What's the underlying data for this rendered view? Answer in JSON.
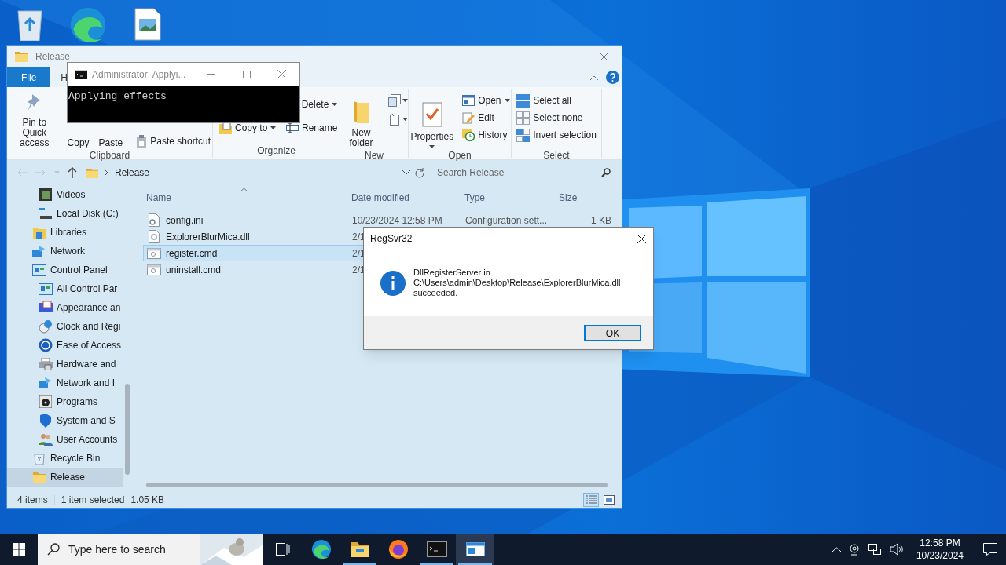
{
  "explorer": {
    "title": "Release",
    "ribbon_tabs": [
      {
        "label": "File",
        "kind": "file"
      },
      {
        "label": "H",
        "kind": "tab"
      }
    ],
    "ribbon_groups": [
      {
        "kind": "clipboard",
        "label": "Clipboard",
        "large": [
          {
            "label": "Pin to Quick access",
            "kind": "pin"
          },
          {
            "label": "Copy"
          },
          {
            "label": "Paste"
          }
        ],
        "small": [
          {
            "label": "Paste shortcut",
            "kind": "paste-shortcut"
          }
        ]
      },
      {
        "kind": "organize",
        "label": "Organize",
        "columns": [
          [
            {
              "label": "Copy to",
              "kind": "copy-to",
              "caret": true
            }
          ],
          [
            {
              "label": "Delete",
              "caret": true
            },
            {
              "label": "Rename",
              "kind": "rename",
              "caret": false
            }
          ]
        ]
      },
      {
        "kind": "new",
        "label": "New",
        "large": [
          {
            "label": "New folder",
            "kind": "folder"
          }
        ]
      },
      {
        "kind": "open",
        "label": "Open",
        "large": [
          {
            "label": "Properties",
            "kind": "properties"
          }
        ],
        "small": [
          {
            "label": "Open",
            "kind": "open",
            "caret": true
          },
          {
            "label": "Edit",
            "kind": "edit",
            "caret": false
          },
          {
            "label": "History",
            "kind": "history",
            "caret": false
          }
        ]
      },
      {
        "kind": "select",
        "label": "Select",
        "small": [
          {
            "label": "Select all",
            "kind": "select-all"
          },
          {
            "label": "Select none",
            "kind": "select-none"
          },
          {
            "label": "Invert selection",
            "kind": "invert"
          }
        ]
      }
    ],
    "address": {
      "path": "Release",
      "search_placeholder": "Search Release"
    },
    "nav": [
      {
        "children": [
          {
            "label": "Videos",
            "kind": "videos",
            "selected": false
          },
          {
            "label": "Local Disk (C:)",
            "kind": "disk",
            "selected": false
          }
        ]
      },
      {
        "label": "Libraries",
        "kind": "libraries",
        "selected": false
      },
      {
        "label": "Network",
        "kind": "network",
        "selected": false
      },
      {
        "label": "Control Panel",
        "kind": "control-panel",
        "selected": false,
        "children": [
          {
            "label": "All Control Par",
            "kind": "control-panel",
            "selected": false
          },
          {
            "label": "Appearance an",
            "kind": "appearance",
            "selected": false
          },
          {
            "label": "Clock and Regi",
            "kind": "clock",
            "selected": false
          },
          {
            "label": "Ease of Access",
            "kind": "ease",
            "selected": false
          },
          {
            "label": "Hardware and",
            "kind": "hardware",
            "selected": false
          },
          {
            "label": "Network and I",
            "kind": "network",
            "selected": false
          },
          {
            "label": "Programs",
            "kind": "programs",
            "selected": false
          },
          {
            "label": "System and S",
            "kind": "system",
            "selected": false
          },
          {
            "label": "User Accounts",
            "kind": "users",
            "selected": false
          }
        ]
      },
      {
        "label": "Recycle Bin",
        "kind": "recycle",
        "selected": false
      },
      {
        "label": "Release",
        "kind": "folder",
        "selected": true
      }
    ],
    "columns": [
      "Name",
      "Date modified",
      "Type",
      "Size"
    ],
    "files": [
      {
        "name": "config.ini",
        "kind": "settings",
        "date": "10/23/2024 12:58 PM",
        "type": "Configuration sett...",
        "size": "1 KB",
        "selected": false
      },
      {
        "name": "ExplorerBlurMica.dll",
        "kind": "dll",
        "date": "2/1",
        "selected": false
      },
      {
        "name": "register.cmd",
        "kind": "script",
        "date": "2/1",
        "selected": true
      },
      {
        "name": "uninstall.cmd",
        "kind": "script",
        "date": "2/1",
        "selected": false
      }
    ],
    "status": {
      "count": "4 items",
      "selection": "1 item selected",
      "size": "1.05 KB"
    },
    "views": [
      {
        "kind": "details",
        "selected": true
      },
      {
        "kind": "large-icons",
        "selected": false
      }
    ]
  },
  "console": {
    "title": "Administrator: Applyi...",
    "output": "Applying effects"
  },
  "dialog": {
    "title": "RegSvr32",
    "message": "DllRegisterServer in\nC:\\Users\\admin\\Desktop\\Release\\ExplorerBlurMica.dll\nsucceeded.",
    "button": "OK"
  },
  "taskbar": {
    "search_placeholder": "Type here to search",
    "apps": [
      {
        "kind": "task-view",
        "running": false,
        "selected": false
      },
      {
        "kind": "edge",
        "running": false,
        "selected": false
      },
      {
        "kind": "explorer",
        "running": true,
        "selected": false
      },
      {
        "kind": "firefox",
        "running": false,
        "selected": false
      },
      {
        "kind": "console",
        "running": true,
        "selected": false
      },
      {
        "kind": "window",
        "running": true,
        "selected": true
      }
    ],
    "time": "12:58 PM",
    "date": "10/23/2024"
  }
}
